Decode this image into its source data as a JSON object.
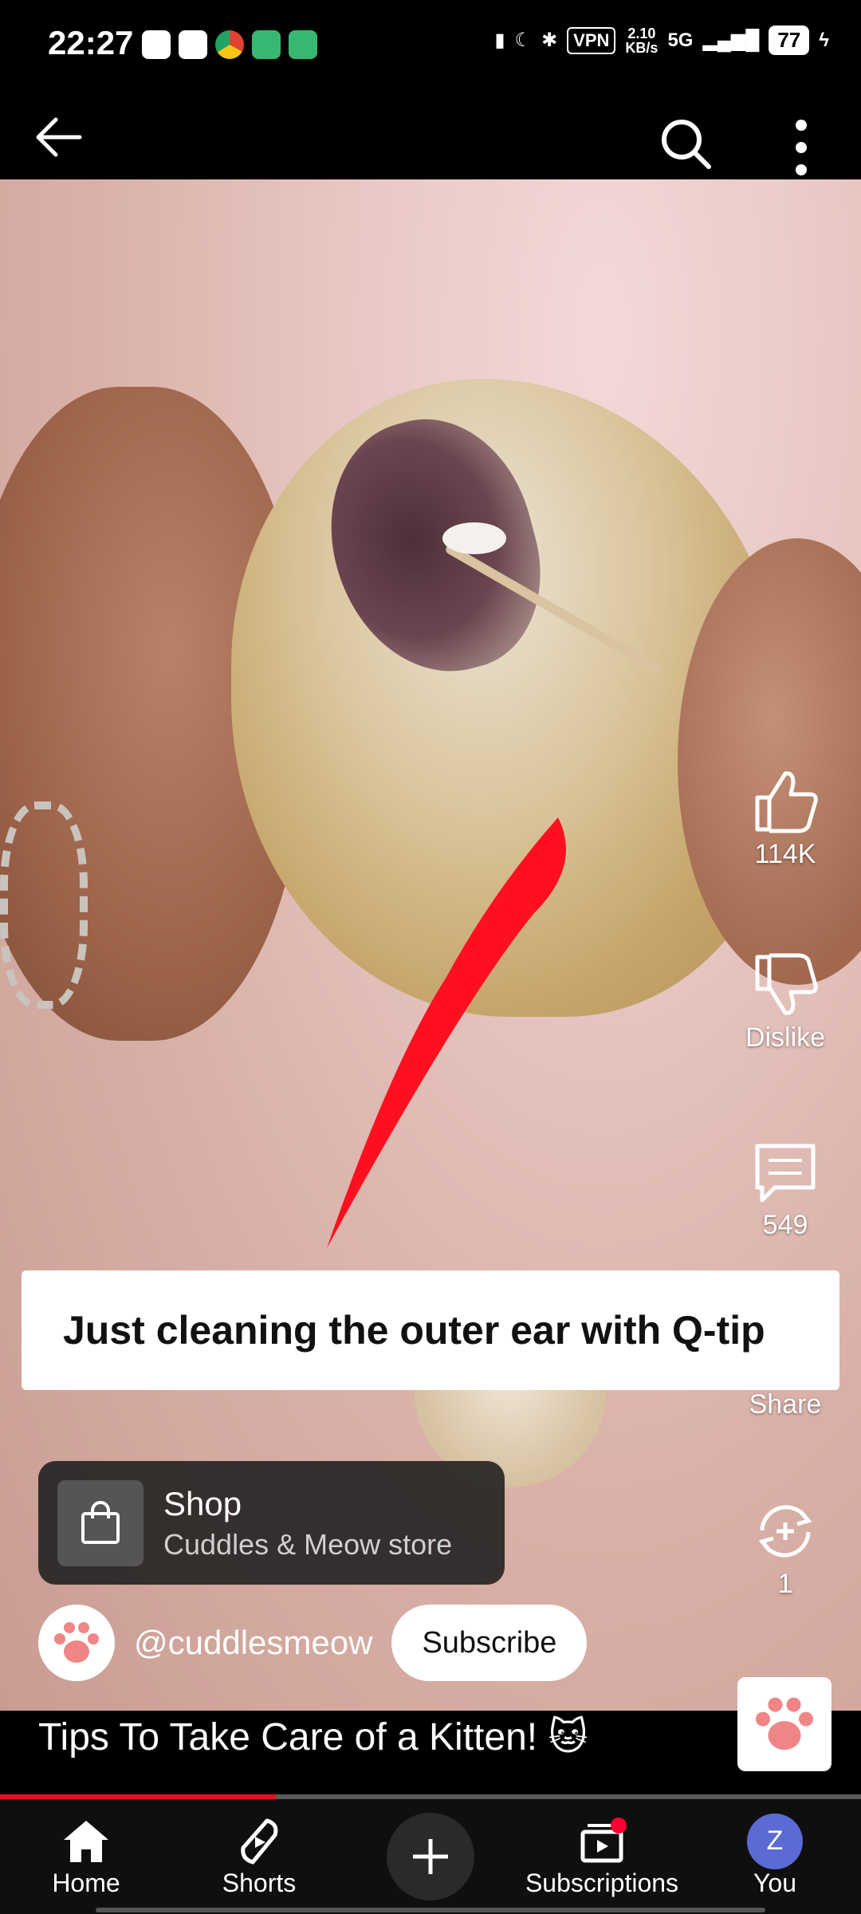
{
  "status_bar": {
    "time": "22:27",
    "vpn": "VPN",
    "speed_value": "2.10",
    "speed_unit": "KB/s",
    "network": "5G",
    "battery": "77"
  },
  "top_bar": {
    "back_icon": "arrow-left-icon",
    "search_icon": "search-icon",
    "more_icon": "more-vertical-icon"
  },
  "video": {
    "caption": "Just cleaning the outer ear with Q-tip"
  },
  "actions": {
    "like_count": "114K",
    "dislike_label": "Dislike",
    "comments_count": "549",
    "share_label": "Share",
    "remix_count": "1"
  },
  "shop": {
    "title": "Shop",
    "store": "Cuddles & Meow store"
  },
  "channel": {
    "handle": "@cuddlesmeow",
    "subscribe_label": "Subscribe"
  },
  "title": "Tips To Take Care of a Kitten! 🐱",
  "progress": 0.32,
  "bottom_nav": {
    "home": "Home",
    "shorts": "Shorts",
    "subscriptions": "Subscriptions",
    "you": "You",
    "you_initial": "Z"
  },
  "colors": {
    "accent_red": "#e8101f",
    "notification_dot": "#ff0033",
    "avatar_blue": "#5b6ad4",
    "paw_pink": "#f08585"
  }
}
